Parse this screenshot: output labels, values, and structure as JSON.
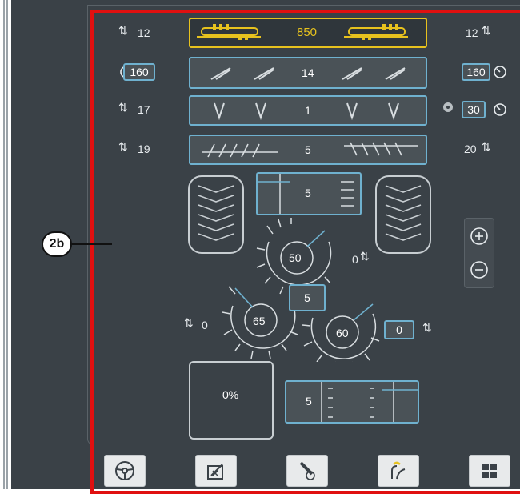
{
  "callout": {
    "label": "2b"
  },
  "rows": [
    {
      "left": "12",
      "center": "850",
      "right": "12"
    },
    {
      "left_box": "160",
      "center": "14",
      "right_box": "160"
    },
    {
      "left": "17",
      "center": "1",
      "right_box": "30"
    },
    {
      "left": "19",
      "center": "5",
      "right": "20"
    }
  ],
  "middle": {
    "concave_box": "5",
    "rotor_top": "50",
    "rotor_top_adjust": "0",
    "rotor_center_box": "5",
    "rotor_left": "65",
    "rotor_left_adjust": "0",
    "rotor_right": "60",
    "rotor_right_box": "0"
  },
  "tank": {
    "percent": "0%"
  },
  "sieve": {
    "value": "5"
  },
  "icons": {
    "up_down": "up-down-arrows-icon",
    "speedometer": "speedometer-icon",
    "fan": "fan-icon",
    "plus": "plus-icon",
    "minus": "minus-icon",
    "steering": "steering-wheel-icon",
    "calibrate": "calibration-icon",
    "header": "header-icon",
    "unload": "unloading-icon",
    "menu": "grid-menu-icon"
  },
  "colors": {
    "accent_yellow": "#e7c21e",
    "accent_blue": "#6fb1cf",
    "highlight_red": "#e01010",
    "background": "#3a4147"
  }
}
